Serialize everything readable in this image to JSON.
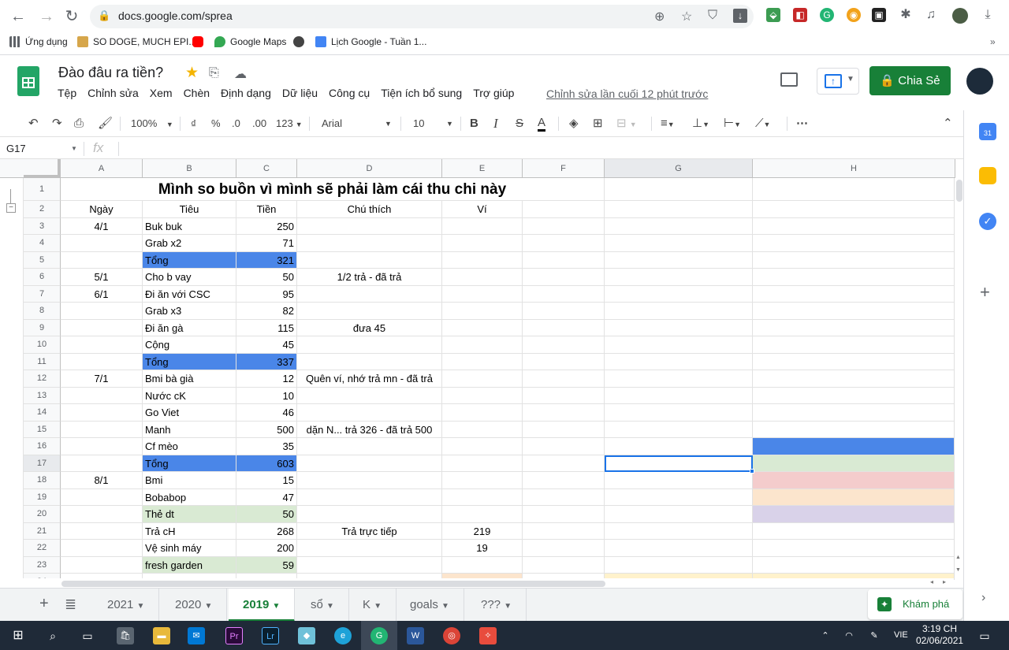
{
  "browser": {
    "url": "docs.google.com/sprea",
    "bookmarks": [
      "Ứng dụng",
      "SO DOGE, MUCH EPI...",
      "",
      "Google Maps",
      "",
      "Lịch Google - Tuần 1..."
    ]
  },
  "doc": {
    "title": "Đào đâu ra tiền?",
    "menu": [
      "Tệp",
      "Chỉnh sửa",
      "Xem",
      "Chèn",
      "Định dạng",
      "Dữ liệu",
      "Công cụ",
      "Tiện ích bổ sung",
      "Trợ giúp"
    ],
    "last_edit": "Chỉnh sửa lần cuối 12 phút trước",
    "share_label": "Chia Sẻ"
  },
  "toolbar": {
    "zoom": "100%",
    "currency": "₫",
    "percent": "%",
    "dec_less": ".0",
    "dec_more": ".00",
    "more_formats": "123",
    "font": "Arial",
    "size": "10"
  },
  "formula_bar": {
    "name_box": "G17",
    "fx": "fx"
  },
  "columns": [
    "A",
    "B",
    "C",
    "D",
    "E",
    "F",
    "G",
    "H"
  ],
  "rows": [
    "1",
    "2",
    "3",
    "4",
    "5",
    "6",
    "7",
    "8",
    "9",
    "10",
    "11",
    "12",
    "13",
    "14",
    "15",
    "16",
    "17",
    "18",
    "19",
    "20",
    "21",
    "22",
    "23",
    "24"
  ],
  "sheet": {
    "title": "Mình so buồn vì mình sẽ phải làm cái thu chi này",
    "headers": {
      "A": "Ngày",
      "B": "Tiêu",
      "C": "Tiền",
      "D": "Chú thích",
      "E": "Ví"
    },
    "data": [
      {
        "a": "4/1",
        "b": "Buk buk",
        "c": "250",
        "d": "",
        "e": ""
      },
      {
        "a": "",
        "b": "Grab x2",
        "c": "71",
        "d": "",
        "e": ""
      },
      {
        "a": "",
        "b": "Tổng",
        "c": "321",
        "d": "",
        "e": ""
      },
      {
        "a": "5/1",
        "b": "Cho b vay",
        "c": "50",
        "d": "1/2 trả - đã trả",
        "e": ""
      },
      {
        "a": "6/1",
        "b": "Đi ăn với CSC",
        "c": "95",
        "d": "",
        "e": ""
      },
      {
        "a": "",
        "b": "Grab x3",
        "c": "82",
        "d": "",
        "e": ""
      },
      {
        "a": "",
        "b": "Đi ăn gà",
        "c": "115",
        "d": "đưa 45",
        "e": ""
      },
      {
        "a": "",
        "b": "Cộng",
        "c": "45",
        "d": "",
        "e": ""
      },
      {
        "a": "",
        "b": "Tổng",
        "c": "337",
        "d": "",
        "e": ""
      },
      {
        "a": "7/1",
        "b": "Bmi bà già",
        "c": "12",
        "d": "Quên ví, nhớ trả mn - đã trả",
        "e": ""
      },
      {
        "a": "",
        "b": "Nước cK",
        "c": "10",
        "d": "",
        "e": ""
      },
      {
        "a": "",
        "b": "Go Viet",
        "c": "46",
        "d": "",
        "e": ""
      },
      {
        "a": "",
        "b": "Manh",
        "c": "500",
        "d": "dặn N... trả 326 - đã trả 500",
        "e": ""
      },
      {
        "a": "",
        "b": "Cf mèo",
        "c": "35",
        "d": "",
        "e": ""
      },
      {
        "a": "",
        "b": "Tổng",
        "c": "603",
        "d": "",
        "e": ""
      },
      {
        "a": "8/1",
        "b": "Bmi",
        "c": "15",
        "d": "",
        "e": ""
      },
      {
        "a": "",
        "b": "Bobabop",
        "c": "47",
        "d": "",
        "e": ""
      },
      {
        "a": "",
        "b": "Thẻ dt",
        "c": "50",
        "d": "",
        "e": ""
      },
      {
        "a": "",
        "b": "Trả cH",
        "c": "268",
        "d": "Trả trực tiếp",
        "e": "219"
      },
      {
        "a": "",
        "b": "Vệ sinh máy",
        "c": "200",
        "d": "",
        "e": "19"
      },
      {
        "a": "",
        "b": "fresh garden",
        "c": "59",
        "d": "",
        "e": ""
      }
    ]
  },
  "colors": {
    "total_blue": "#4a86e8",
    "light_green": "#d9ead3",
    "light_red": "#f4cccc",
    "light_orange": "#fce5cd",
    "light_purple": "#d9d2e9",
    "light_yellow": "#fff2cc",
    "brand_green": "#188038"
  },
  "sheet_tabs": [
    "2021",
    "2020",
    "2019",
    "sổ",
    "K",
    "goals",
    "???"
  ],
  "active_tab": "2019",
  "explore_label": "Khám phá",
  "taskbar": {
    "lang": "VIE",
    "time": "3:19 CH",
    "date": "02/06/2021"
  }
}
